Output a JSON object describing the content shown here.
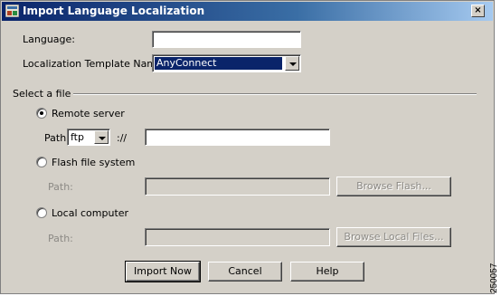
{
  "window": {
    "title": "Import Language Localization",
    "close_glyph": "×"
  },
  "form": {
    "language_label": "Language:",
    "language_value": "",
    "template_label": "Localization Template Name:",
    "template_value": "AnyConnect"
  },
  "select_file": {
    "group_label": "Select a file",
    "remote_server": {
      "label": "Remote server",
      "checked": true,
      "path_label": "Path",
      "protocol": "ftp",
      "separator": "://",
      "path_value": ""
    },
    "flash": {
      "label": "Flash file system",
      "checked": false,
      "path_label": "Path:",
      "browse_label": "Browse Flash..."
    },
    "local": {
      "label": "Local computer",
      "checked": false,
      "path_label": "Path:",
      "browse_label": "Browse Local Files..."
    }
  },
  "buttons": {
    "import_label": "Import Now",
    "cancel_label": "Cancel",
    "help_label": "Help"
  },
  "figure_id": "250057",
  "colors": {
    "titlebar_start": "#0a246a",
    "titlebar_end": "#a6caf0",
    "dialog_bg": "#d4d0c8",
    "disabled_text": "#8c8a85"
  }
}
